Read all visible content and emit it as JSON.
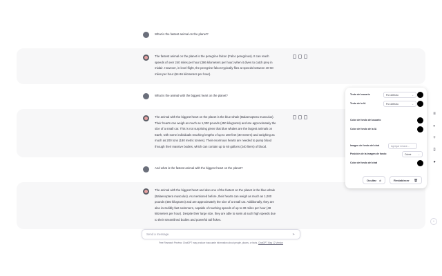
{
  "conversation": {
    "q1": "What is the fastest animal on the planet?",
    "a1": [
      "The fastest animal on the planet is the peregrine falcon (Falco peregrinus). It can reach",
      "speeds of over 240 miles per hour (386 kilometers per hour) when it dives to catch prey in",
      "midair. However, in level flight, the peregrine falcon typically flies at speeds between 40-60",
      "miles per hour (64-96 kilometers per hour)."
    ],
    "q2": "What is the animal with the biggest heart on the planet?",
    "a2": [
      "The animal with the biggest heart on the planet is the blue whale (Balaenoptera musculus).",
      "Their hearts can weigh as much as 1,000 pounds (450 kilograms) and are approximately the",
      "size of a small car. This is not surprising given that blue whales are the largest animals on",
      "Earth, with some individuals reaching lengths of up to 100 feet (30 meters) and weighing as",
      "much as 200 tons (180 metric tonnes). Their enormous hearts are needed to pump blood",
      "through their massive bodies, which can contain up to 60 gallons (240 liters) of blood."
    ],
    "q3": "And what is the fastest animal with the biggest heart on the planet?",
    "a3": [
      "The animal with the biggest heart and also one of the fastest on the planet is the blue whale",
      "(Balaenoptera musculus). As mentioned before, their hearts can weigh as much as 1,000",
      "pounds (450 kilograms) and are approximately the size of a small car. Additionally, they are",
      "also incredibly fast swimmers, capable of reaching speeds of up to 30 miles per hour (48",
      "kilometers per hour). Despite their large size, they are able to swim at such high speeds due",
      "to their streamlined bodies and powerful tail flukes."
    ]
  },
  "composer": {
    "placeholder": "Send a message."
  },
  "disclaimer": {
    "text": "Free Research Preview. ChatGPT may produce inaccurate information about people, places, or facts.",
    "link": "ChatGPT May 12 Version"
  },
  "panel": {
    "user_text_label": "Texto del usuario",
    "user_text_value": "Por defecto",
    "ai_text_label": "Texto de la IA",
    "ai_text_value": "Por defecto",
    "user_bg_label": "Color de fondo del usuario",
    "ai_bg_label": "Color de fondo de la IA",
    "chat_bg_image_label": "Imagen de fondo del chat",
    "chat_bg_image_placeholder": "Agregar enlace...",
    "bg_image_position_label": "Posición de la imagen de fondo",
    "bg_image_position_value": "Cubrir",
    "chat_bg_color_label": "Color de fondo del chat",
    "hide_button": "Ocultar",
    "reset_button": "Restablecer",
    "swatch_color": "#000000"
  },
  "icons": {
    "copy": "copy-icon",
    "thumb_up": "thumbs-up-icon",
    "thumb_down": "thumbs-down-icon",
    "menu": "menu-icon",
    "theme": "contrast-icon",
    "add": "plus-icon",
    "document": "document-icon",
    "palette": "palette-icon",
    "scroll_down": "arrow-down-icon",
    "send": "send-icon"
  }
}
